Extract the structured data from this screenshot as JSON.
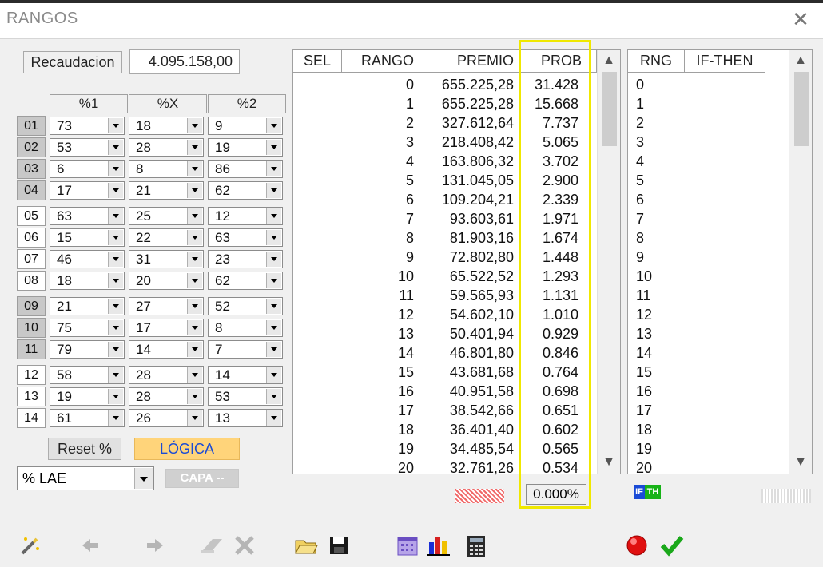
{
  "window": {
    "title": "RANGOS",
    "close_glyph": "✕"
  },
  "left": {
    "recaudacion_label": "Recaudacion",
    "recaudacion_value": "4.095.158,00",
    "col_headers": [
      "%1",
      "%X",
      "%2"
    ],
    "rows": [
      {
        "num": "01",
        "v1": "73",
        "vx": "18",
        "v2": "9"
      },
      {
        "num": "02",
        "v1": "53",
        "vx": "28",
        "v2": "19"
      },
      {
        "num": "03",
        "v1": "6",
        "vx": "8",
        "v2": "86"
      },
      {
        "num": "04",
        "v1": "17",
        "vx": "21",
        "v2": "62"
      },
      {
        "num": "05",
        "v1": "63",
        "vx": "25",
        "v2": "12"
      },
      {
        "num": "06",
        "v1": "15",
        "vx": "22",
        "v2": "63"
      },
      {
        "num": "07",
        "v1": "46",
        "vx": "31",
        "v2": "23"
      },
      {
        "num": "08",
        "v1": "18",
        "vx": "20",
        "v2": "62"
      },
      {
        "num": "09",
        "v1": "21",
        "vx": "27",
        "v2": "52"
      },
      {
        "num": "10",
        "v1": "75",
        "vx": "17",
        "v2": "8"
      },
      {
        "num": "11",
        "v1": "79",
        "vx": "14",
        "v2": "7"
      },
      {
        "num": "12",
        "v1": "58",
        "vx": "28",
        "v2": "14"
      },
      {
        "num": "13",
        "v1": "19",
        "vx": "28",
        "v2": "53"
      },
      {
        "num": "14",
        "v1": "61",
        "vx": "26",
        "v2": "13"
      }
    ],
    "reset_label": "Reset %",
    "logica_label": "LÓGICA",
    "lae_select": "% LAE",
    "capa_label": "CAPA --"
  },
  "grid": {
    "headers": {
      "sel": "SEL",
      "rango": "RANGO",
      "premio": "PREMIO",
      "prob": "PROB"
    },
    "rows": [
      {
        "rango": "0",
        "premio": "655.225,28",
        "prob": "31.428"
      },
      {
        "rango": "1",
        "premio": "655.225,28",
        "prob": "15.668"
      },
      {
        "rango": "2",
        "premio": "327.612,64",
        "prob": "7.737"
      },
      {
        "rango": "3",
        "premio": "218.408,42",
        "prob": "5.065"
      },
      {
        "rango": "4",
        "premio": "163.806,32",
        "prob": "3.702"
      },
      {
        "rango": "5",
        "premio": "131.045,05",
        "prob": "2.900"
      },
      {
        "rango": "6",
        "premio": "109.204,21",
        "prob": "2.339"
      },
      {
        "rango": "7",
        "premio": "93.603,61",
        "prob": "1.971"
      },
      {
        "rango": "8",
        "premio": "81.903,16",
        "prob": "1.674"
      },
      {
        "rango": "9",
        "premio": "72.802,80",
        "prob": "1.448"
      },
      {
        "rango": "10",
        "premio": "65.522,52",
        "prob": "1.293"
      },
      {
        "rango": "11",
        "premio": "59.565,93",
        "prob": "1.131"
      },
      {
        "rango": "12",
        "premio": "54.602,10",
        "prob": "1.010"
      },
      {
        "rango": "13",
        "premio": "50.401,94",
        "prob": "0.929"
      },
      {
        "rango": "14",
        "premio": "46.801,80",
        "prob": "0.846"
      },
      {
        "rango": "15",
        "premio": "43.681,68",
        "prob": "0.764"
      },
      {
        "rango": "16",
        "premio": "40.951,58",
        "prob": "0.698"
      },
      {
        "rango": "17",
        "premio": "38.542,66",
        "prob": "0.651"
      },
      {
        "rango": "18",
        "premio": "36.401,40",
        "prob": "0.602"
      },
      {
        "rango": "19",
        "premio": "34.485,54",
        "prob": "0.565"
      },
      {
        "rango": "20",
        "premio": "32.761,26",
        "prob": "0.534"
      }
    ],
    "prob_total": "0.000%"
  },
  "grid2": {
    "headers": {
      "rng": "RNG",
      "ifthen": "IF-THEN"
    },
    "rows": [
      "0",
      "1",
      "2",
      "3",
      "4",
      "5",
      "6",
      "7",
      "8",
      "9",
      "10",
      "11",
      "12",
      "13",
      "14",
      "15",
      "16",
      "17",
      "18",
      "19",
      "20"
    ],
    "badge_if": "IF",
    "badge_th": "TH"
  },
  "colors": {
    "highlight": "#f0e800",
    "logica_bg": "#ffd47a",
    "logica_text": "#1a4bd6"
  }
}
